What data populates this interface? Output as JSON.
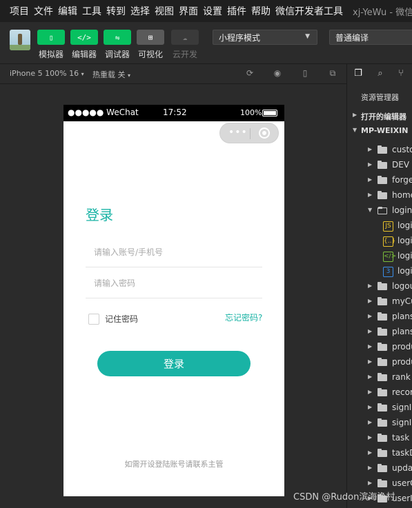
{
  "menu": {
    "items": [
      "项目",
      "文件",
      "编辑",
      "工具",
      "转到",
      "选择",
      "视图",
      "界面",
      "设置",
      "插件",
      "帮助",
      "微信开发者工具"
    ],
    "window_title": "xj-YeWu - 微信"
  },
  "toolbar": {
    "buttons": [
      {
        "label": "模拟器",
        "icon": "phone-icon"
      },
      {
        "label": "编辑器",
        "icon": "code-icon"
      },
      {
        "label": "调试器",
        "icon": "sliders-icon"
      },
      {
        "label": "可视化",
        "icon": "layout-icon"
      },
      {
        "label": "云开发",
        "icon": "cloud-icon"
      }
    ],
    "mode_select": "小程序模式",
    "compile_select": "普通编译"
  },
  "subbar": {
    "device": "iPhone 5 100% 16",
    "hot_reload": "热重载 关"
  },
  "phone": {
    "carrier": "●●●●● WeChat",
    "time": "17:52",
    "battery": "100%",
    "capsule_dots": "•••",
    "page": {
      "title": "登录",
      "account_placeholder": "请输入账号/手机号",
      "password_placeholder": "请输入密码",
      "remember_label": "记住密码",
      "forgot_link": "忘记密码?",
      "login_button": "登录",
      "footer_note": "如需开设登陆账号请联系主管"
    }
  },
  "explorer": {
    "title": "资源管理器",
    "open_editors": "打开的编辑器",
    "project": "MP-WEIXIN",
    "folders_before": [
      "custo",
      "DEV",
      "forge",
      "home"
    ],
    "open_folder": "login",
    "login_files": [
      {
        "name": "logi",
        "type": "JS",
        "color": "#e8c22a"
      },
      {
        "name": "logi",
        "type": "{..}",
        "color": "#e8c22a"
      },
      {
        "name": "logi",
        "type": "</>",
        "color": "#7cbf3a"
      },
      {
        "name": "logi",
        "type": "3",
        "color": "#3a8ee8"
      }
    ],
    "folders_after": [
      "logou",
      "myCu",
      "plans",
      "plans",
      "produ",
      "produ",
      "rank",
      "recor",
      "signI",
      "signI",
      "task",
      "taskD",
      "upda",
      "userC",
      "userI"
    ]
  },
  "watermark": "CSDN @Rudon滨海渔村"
}
